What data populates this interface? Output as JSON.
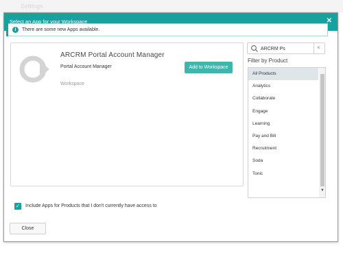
{
  "background": {
    "text": "Settings"
  },
  "modal": {
    "title": "Select an App for your Workspace",
    "close_icon": "close-icon",
    "accent_color": "#17a2a0"
  },
  "notice": {
    "icon": "info-icon",
    "text": "There are some new Apps available."
  },
  "app_card": {
    "logo_icon": "app-logo",
    "title": "ARCRM Portal Account Manager",
    "subtitle": "Portal Account Manager",
    "category": "Workspace",
    "add_label": "Add to Workspace"
  },
  "search": {
    "icon": "search-icon",
    "value": "ARCRM Ps",
    "clear_label": "×"
  },
  "filter": {
    "heading": "Filter by Product",
    "items": [
      {
        "label": "All Products",
        "selected": true
      },
      {
        "label": "Analytics",
        "selected": false
      },
      {
        "label": "Collaborate",
        "selected": false
      },
      {
        "label": "Engage",
        "selected": false
      },
      {
        "label": "Learning",
        "selected": false
      },
      {
        "label": "Pay and Bill",
        "selected": false
      },
      {
        "label": "Recruitment",
        "selected": false
      },
      {
        "label": "Soda",
        "selected": false
      },
      {
        "label": "Tonic",
        "selected": false
      }
    ]
  },
  "include": {
    "checked": true,
    "label": "Include Apps for Products that I don't currently have access to"
  },
  "footer": {
    "close_label": "Close"
  }
}
